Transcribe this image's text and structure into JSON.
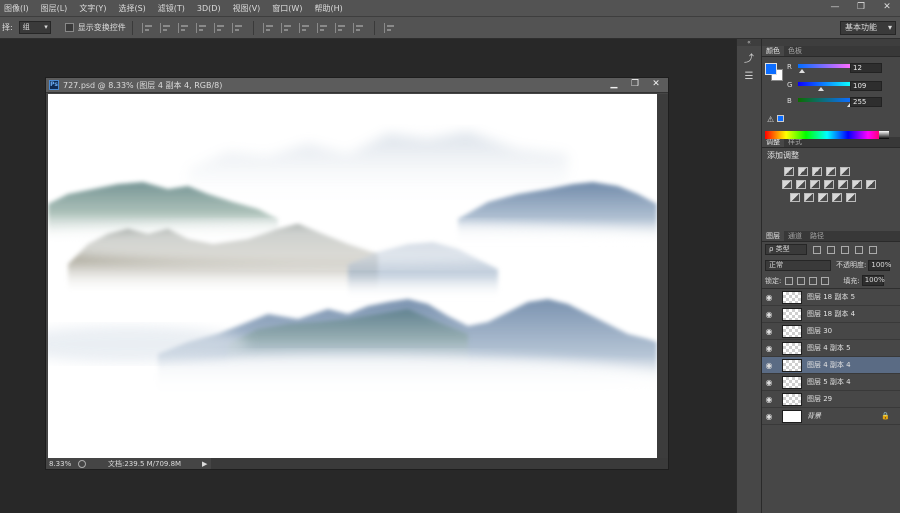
{
  "menu": [
    "图像(I)",
    "图层(L)",
    "文字(Y)",
    "选择(S)",
    "滤镜(T)",
    "3D(D)",
    "视图(V)",
    "窗口(W)",
    "帮助(H)"
  ],
  "window_controls": [
    "—",
    "❐",
    "✕"
  ],
  "options": {
    "tool_label": "择:",
    "select_value": "组",
    "checkbox_label": "显示变换控件",
    "workspace": "基本功能"
  },
  "document": {
    "title": "727.psd @ 8.33% (图层 4 副本 4, RGB/8)",
    "zoom": "8.33%",
    "doc_size": "文档:239.5 M/709.8M",
    "controls": [
      "▁",
      "❐",
      "✕"
    ]
  },
  "color_panel": {
    "tabs": [
      "颜色",
      "色板"
    ],
    "channels": [
      {
        "label": "R",
        "value": "12"
      },
      {
        "label": "G",
        "value": "109"
      },
      {
        "label": "B",
        "value": "255"
      }
    ],
    "fg_color": "#0c6dff"
  },
  "adjustments": {
    "tabs": [
      "调整",
      "样式"
    ],
    "title": "添加调整"
  },
  "layers_panel": {
    "tabs": [
      "图层",
      "通道",
      "路径"
    ],
    "filter": "ρ 类型",
    "blend_mode": "正常",
    "opacity_label": "不透明度:",
    "opacity_value": "100%",
    "lock_label": "锁定:",
    "fill_label": "填充:",
    "fill_value": "100%",
    "layers": [
      {
        "name": "图层 18 副本 5",
        "selected": false
      },
      {
        "name": "图层 18 副本 4",
        "selected": false
      },
      {
        "name": "图层 30",
        "selected": false
      },
      {
        "name": "图层 4 副本 5",
        "selected": false
      },
      {
        "name": "图层 4 副本 4",
        "selected": true
      },
      {
        "name": "图层 5 副本 4",
        "selected": false
      },
      {
        "name": "图层 29",
        "selected": false
      },
      {
        "name": "背景",
        "selected": false,
        "locked": true
      }
    ]
  }
}
